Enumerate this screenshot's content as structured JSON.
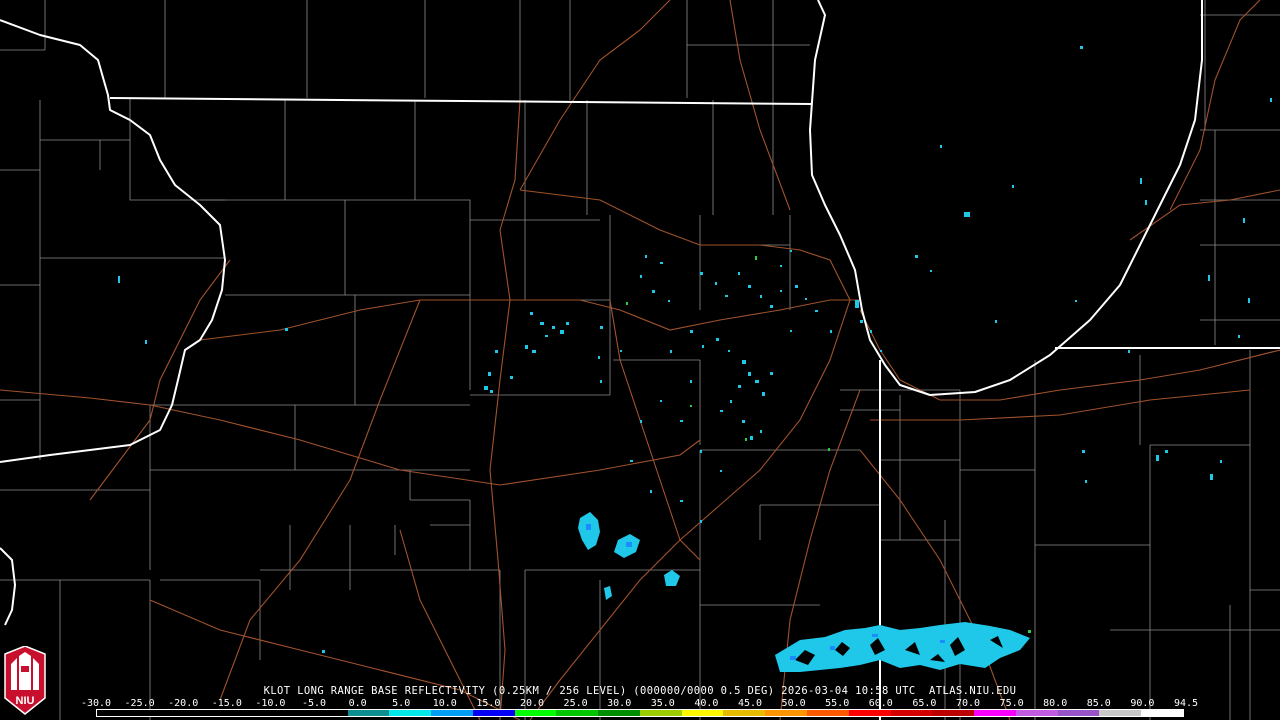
{
  "caption": "KLOT LONG RANGE BASE REFLECTIVITY (0.25KM / 256 LEVEL) (000000/0000 0.5 DEG) 2026-03-04 10:58 UTC  ATLAS.NIU.EDU",
  "logo": {
    "text": "NIU",
    "icon": "niu-logo-icon"
  },
  "scale": {
    "labels": [
      "-30.0",
      "-25.0",
      "-20.0",
      "-15.0",
      "-10.0",
      "-5.0",
      "0.0",
      "5.0",
      "10.0",
      "15.0",
      "20.0",
      "25.0",
      "30.0",
      "35.0",
      "40.0",
      "45.0",
      "50.0",
      "55.0",
      "60.0",
      "65.0",
      "70.0",
      "75.0",
      "80.0",
      "85.0",
      "90.0",
      "94.5"
    ],
    "colors": [
      "#000000",
      "#000000",
      "#000000",
      "#000000",
      "#000000",
      "#000000",
      "#04e9e7",
      "#019ff4",
      "#0300f4",
      "#02fd02",
      "#01c501",
      "#008e00",
      "#fdf802",
      "#e5bc00",
      "#fd9500",
      "#fd0000",
      "#d40000",
      "#bc0000",
      "#f800fd",
      "#9854c6",
      "#fdfdfd",
      "#ffffff"
    ]
  },
  "colors": {
    "background": "#000000",
    "state_border": "#ffffff",
    "county_border": "#8c8c8c",
    "highway": "#a0522d",
    "echo_light": "#1fc8e8",
    "echo_mid": "#1a8cff"
  }
}
